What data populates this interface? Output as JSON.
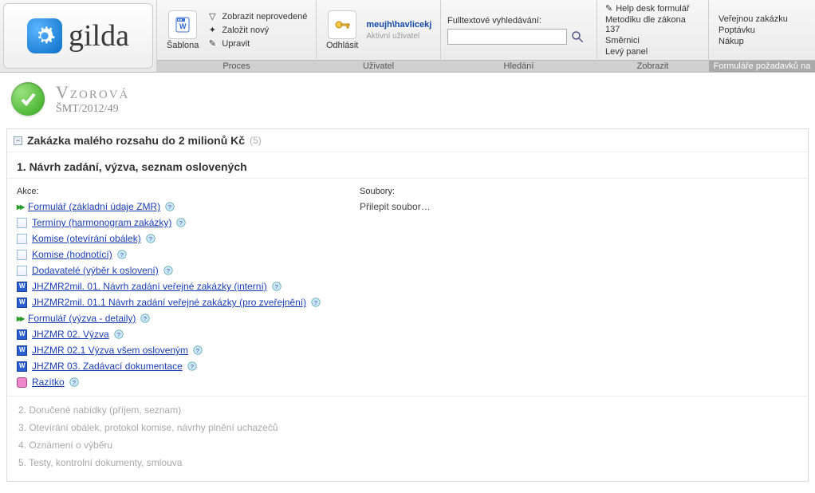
{
  "ribbon": {
    "proces": {
      "label": "Proces",
      "sablona": "Šablona",
      "items": [
        "Zobrazit neprovedené",
        "Založit nový",
        "Upravit"
      ]
    },
    "uzivatel": {
      "label": "Uživatel",
      "logout": "Odhlásit",
      "user": "meujh\\havlicekj",
      "active": "Aktivní uživatel"
    },
    "hledani": {
      "label": "Hledání",
      "prompt": "Fulltextové vyhledávání:",
      "placeholder": ""
    },
    "zobrazit": {
      "label": "Zobrazit",
      "items": [
        "Help desk formulář",
        "Metodiku dle zákona 137",
        "Směrnici",
        "Levý panel"
      ]
    },
    "formulare": {
      "label": "Formuláře požadavků na",
      "items": [
        "Veřejnou zakázku",
        "Poptávku",
        "Nákup"
      ]
    }
  },
  "title": {
    "name": "Vzorová",
    "code": "ŠMT/2012/49"
  },
  "section": {
    "title": "Zakázka malého rozsahu do 2 milionů Kč",
    "count": "(5)"
  },
  "step1": {
    "hdr": "1. Návrh zadání, výzva, seznam oslovených",
    "actions_label": "Akce:",
    "files_label": "Soubory:",
    "attach": "Přilepit soubor…",
    "actions": [
      {
        "icon": "arrows",
        "text": "Formulář (základní údaje ZMR)",
        "help": true
      },
      {
        "icon": "list",
        "text": "Termíny (harmonogram zakázky)",
        "help": true
      },
      {
        "icon": "list",
        "text": "Komise (otevírání obálek)",
        "help": true
      },
      {
        "icon": "list",
        "text": "Komise (hodnotící)",
        "help": true
      },
      {
        "icon": "list",
        "text": "Dodavatelé (výběr k oslovení)",
        "help": true
      },
      {
        "icon": "word",
        "text": "JHZMR2mil. 01. Návrh zadání veřejné zakázky (interní)",
        "help": true
      },
      {
        "icon": "word",
        "text": "JHZMR2mil. 01.1 Návrh zadání veřejné zakázky (pro zveřejnění)",
        "help": true
      },
      {
        "icon": "arrows",
        "text": "Formulář (výzva - detaily)",
        "help": true
      },
      {
        "icon": "word",
        "text": "JHZMR 02. Výzva",
        "help": true
      },
      {
        "icon": "word",
        "text": "JHZMR 02.1 Výzva všem osloveným",
        "help": true
      },
      {
        "icon": "word",
        "text": "JHZMR 03. Zadávací dokumentace",
        "help": true
      },
      {
        "icon": "stamp",
        "text": "Razítko",
        "help": true
      }
    ]
  },
  "otherSteps": [
    "2. Doručené nabídky (příjem, seznam)",
    "3. Otevírání obálek, protokol komise, návrhy plnění uchazečů",
    "4. Oznámení o výběru",
    "5. Testy, kontrolní dokumenty, smlouva"
  ]
}
